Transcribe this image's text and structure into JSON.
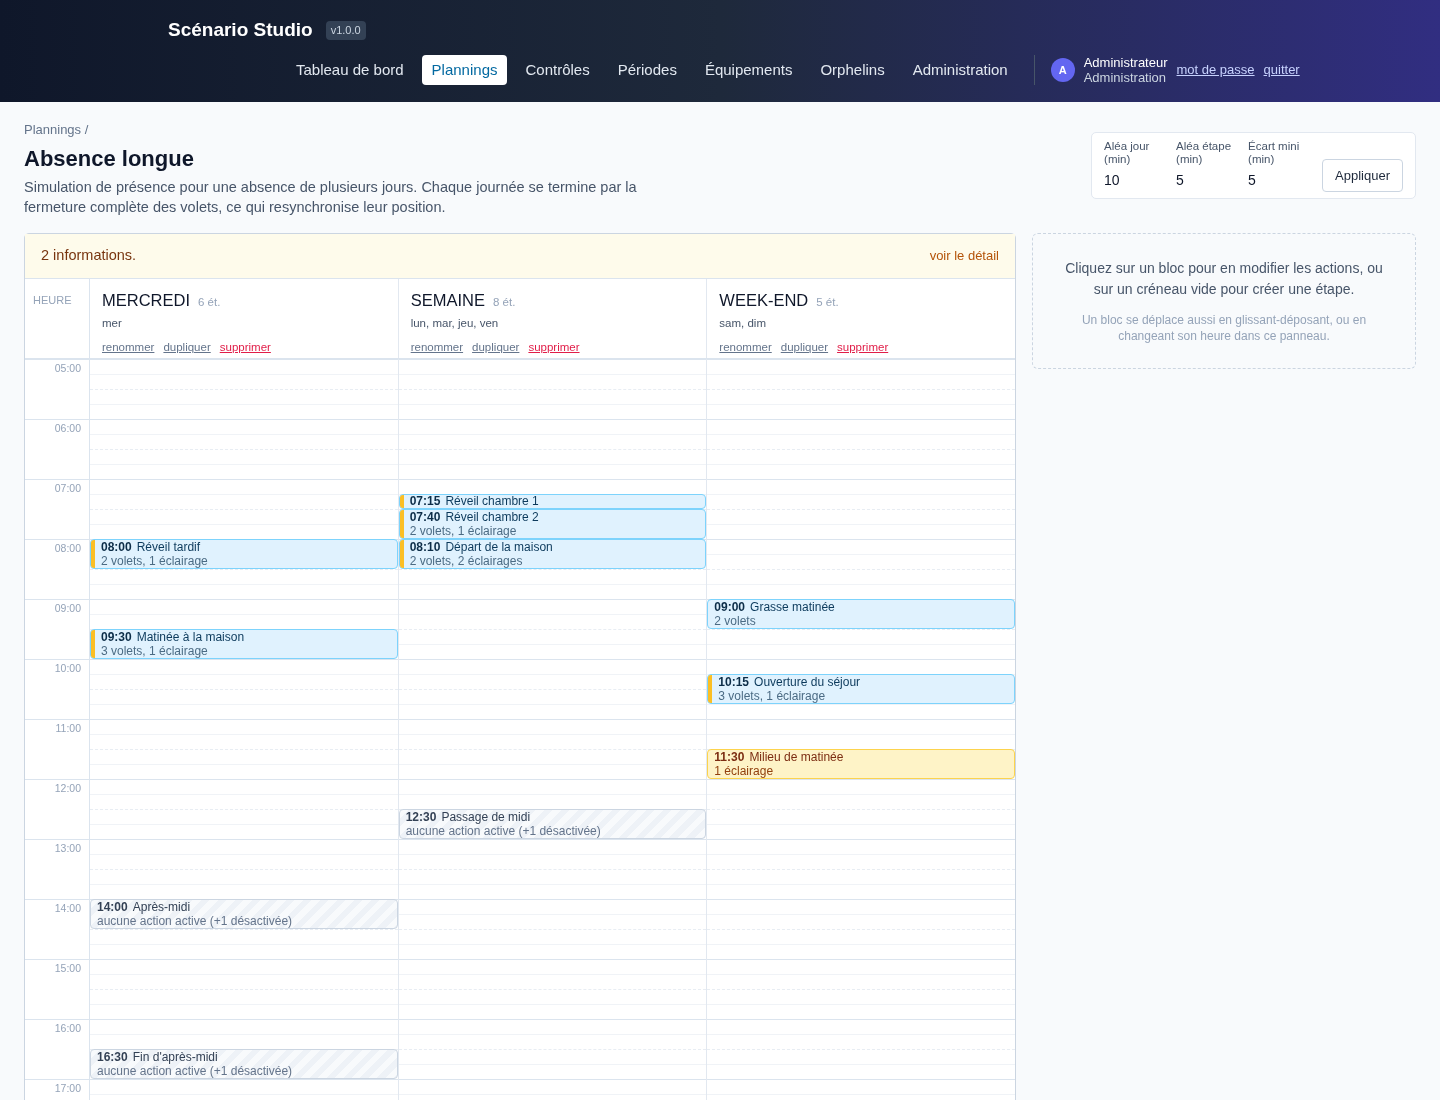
{
  "app": {
    "title": "Scénario Studio",
    "version": "v1.0.0"
  },
  "nav": [
    {
      "label": "Tableau de bord",
      "selected": false
    },
    {
      "label": "Plannings",
      "selected": true
    },
    {
      "label": "Contrôles",
      "selected": false
    },
    {
      "label": "Périodes",
      "selected": false
    },
    {
      "label": "Équipements",
      "selected": false
    },
    {
      "label": "Orphelins",
      "selected": false
    },
    {
      "label": "Administration",
      "selected": false
    }
  ],
  "user": {
    "initial": "A",
    "name": "Administrateur",
    "role": "Administration",
    "links": [
      "mot de passe",
      "quitter"
    ]
  },
  "breadcrumb": "Plannings /",
  "title": "Absence longue",
  "description": "Simulation de présence pour une absence de plusieurs jours. Chaque journée se termine par la fermeture complète des volets, ce qui resynchronise leur position.",
  "params": {
    "fields": [
      {
        "label": "Aléa jour (min)",
        "value": "10"
      },
      {
        "label": "Aléa étape (min)",
        "value": "5"
      },
      {
        "label": "Écart mini (min)",
        "value": "5"
      }
    ],
    "button": "Appliquer"
  },
  "banner": {
    "text": "2 informations.",
    "link": "voir le détail"
  },
  "hour_header": "HEURE",
  "hours": [
    "05:00",
    "06:00",
    "07:00",
    "08:00",
    "09:00",
    "10:00",
    "11:00",
    "12:00",
    "13:00",
    "14:00",
    "15:00",
    "16:00",
    "17:00"
  ],
  "days": [
    {
      "name": "MERCREDI",
      "count": "6 ét.",
      "weekdays": "mer",
      "actions": [
        {
          "label": "renommer",
          "kind": "normal"
        },
        {
          "label": "dupliquer",
          "kind": "normal"
        },
        {
          "label": "supprimer",
          "kind": "danger"
        }
      ],
      "steps": [
        {
          "time": "08:00",
          "title": "Réveil tardif",
          "summary": "2 volets, 1 éclairage",
          "kind": "active",
          "flagged": true
        },
        {
          "time": "09:30",
          "title": "Matinée à la maison",
          "summary": "3 volets, 1 éclairage",
          "kind": "active",
          "flagged": true
        },
        {
          "time": "14:00",
          "title": "Après-midi",
          "summary": "aucune action active (+1 désactivée)",
          "kind": "disabled",
          "flagged": false
        },
        {
          "time": "16:30",
          "title": "Fin d'après-midi",
          "summary": "aucune action active (+1 désactivée)",
          "kind": "disabled",
          "flagged": false
        }
      ]
    },
    {
      "name": "SEMAINE",
      "count": "8 ét.",
      "weekdays": "lun, mar, jeu, ven",
      "actions": [
        {
          "label": "renommer",
          "kind": "normal"
        },
        {
          "label": "dupliquer",
          "kind": "normal"
        },
        {
          "label": "supprimer",
          "kind": "danger"
        }
      ],
      "steps": [
        {
          "time": "07:15",
          "title": "Réveil chambre 1",
          "kind": "active",
          "flagged": true
        },
        {
          "time": "07:40",
          "title": "Réveil chambre 2",
          "summary": "2 volets, 1 éclairage",
          "kind": "active",
          "flagged": true
        },
        {
          "time": "08:10",
          "title": "Départ de la maison",
          "summary": "2 volets, 2 éclairages",
          "kind": "active",
          "flagged": true
        },
        {
          "time": "12:30",
          "title": "Passage de midi",
          "summary": "aucune action active (+1 désactivée)",
          "kind": "disabled",
          "flagged": false
        }
      ]
    },
    {
      "name": "WEEK-END",
      "count": "5 ét.",
      "weekdays": "sam, dim",
      "actions": [
        {
          "label": "renommer",
          "kind": "normal"
        },
        {
          "label": "dupliquer",
          "kind": "normal"
        },
        {
          "label": "supprimer",
          "kind": "danger"
        }
      ],
      "steps": [
        {
          "time": "09:00",
          "title": "Grasse matinée",
          "summary": "2 volets",
          "kind": "active",
          "flagged": false
        },
        {
          "time": "10:15",
          "title": "Ouverture du séjour",
          "summary": "3 volets, 1 éclairage",
          "kind": "active",
          "flagged": true
        },
        {
          "time": "11:30",
          "title": "Milieu de matinée",
          "summary": "1 éclairage",
          "kind": "warning",
          "flagged": false
        }
      ]
    }
  ],
  "help": {
    "main": "Cliquez sur un bloc pour en modifier les actions, ou sur un créneau vide pour créer une étape.",
    "hint": "Un bloc se déplace aussi en glissant-déposant, ou en changeant son heure dans ce panneau."
  }
}
